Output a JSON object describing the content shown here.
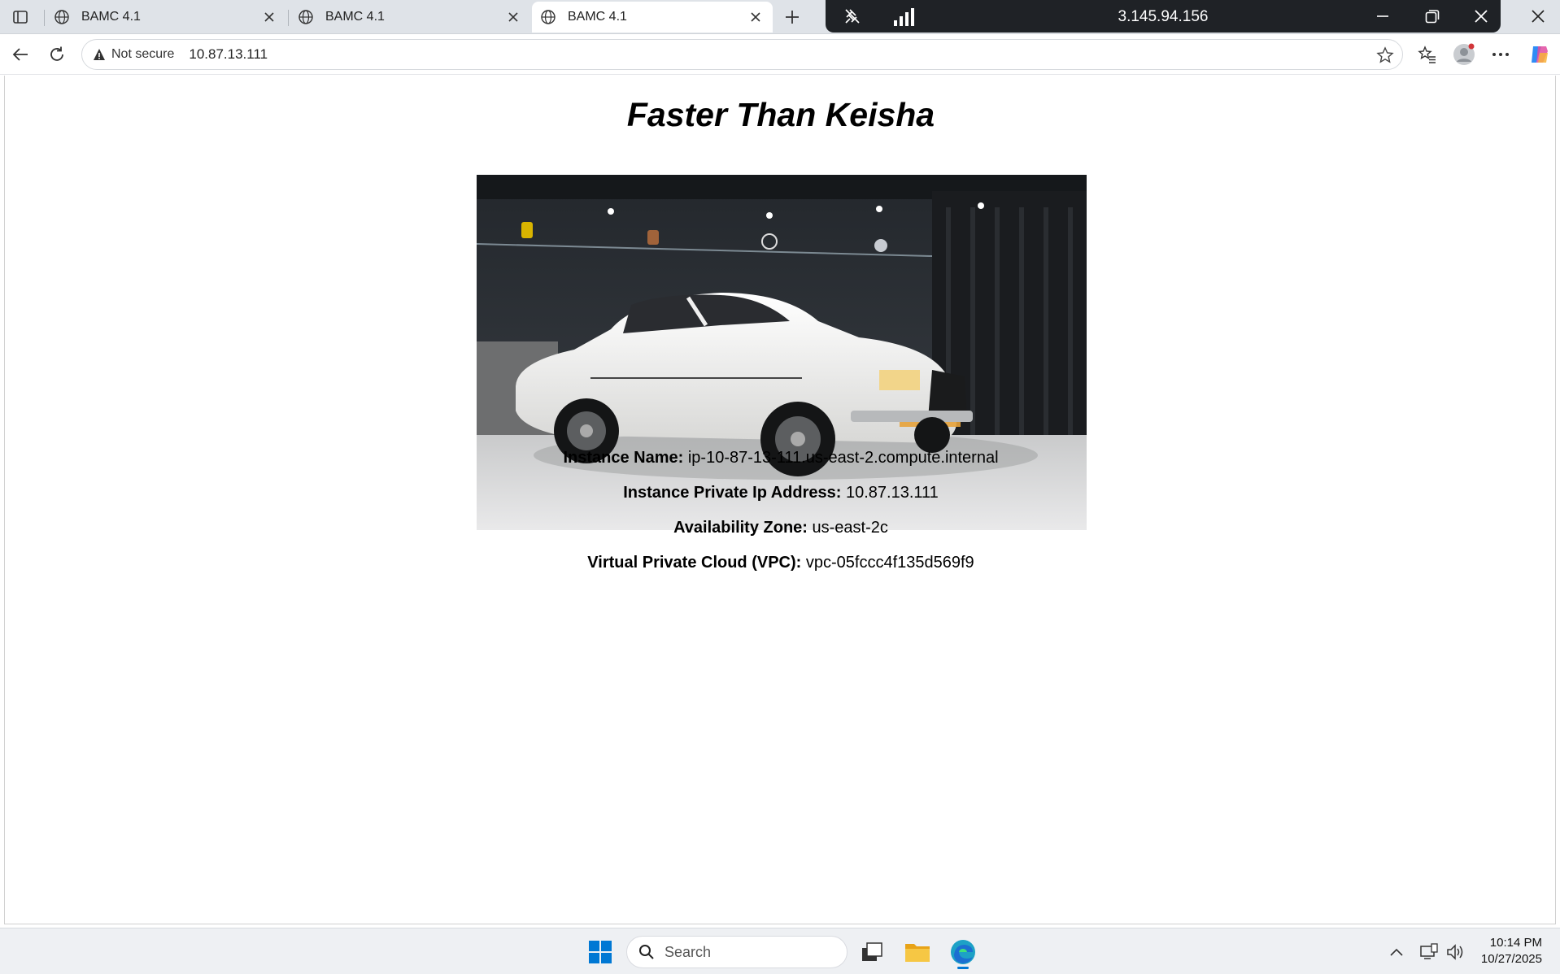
{
  "browser": {
    "tabs": [
      {
        "title": "BAMC 4.1",
        "active": false
      },
      {
        "title": "BAMC 4.1",
        "active": false
      },
      {
        "title": "BAMC 4.1",
        "active": true
      }
    ],
    "address": {
      "security_label": "Not secure",
      "url": "10.87.13.111"
    }
  },
  "remote_session": {
    "host": "3.145.94.156"
  },
  "page": {
    "title": "Faster Than Keisha",
    "image_alt": "Buick",
    "fields": [
      {
        "label": "Instance Name:",
        "value": "ip-10-87-13-111.us-east-2.compute.internal"
      },
      {
        "label": "Instance Private Ip Address:",
        "value": "10.87.13.111"
      },
      {
        "label": "Availability Zone:",
        "value": "us-east-2c"
      },
      {
        "label": "Virtual Private Cloud (VPC):",
        "value": "vpc-05fccc4f135d569f9"
      }
    ]
  },
  "taskbar": {
    "search_placeholder": "Search",
    "time": "10:14 PM",
    "date": "10/27/2025"
  },
  "colors": {
    "accent": "#0078d4",
    "page_bg": "#ffffff",
    "tabstrip_bg": "#dfe3e8",
    "rdp_bar_bg": "#1f2226"
  },
  "icons": [
    "tab-actions-icon",
    "globe-icon",
    "close-icon",
    "plus-icon",
    "pin-icon",
    "signal-icon",
    "minimize-icon",
    "restore-icon",
    "back-icon",
    "refresh-icon",
    "warning-icon",
    "star-icon",
    "favorites-icon",
    "profile-icon",
    "more-icon",
    "copilot-icon",
    "windows-start-icon",
    "search-icon",
    "task-view-icon",
    "file-explorer-icon",
    "edge-icon",
    "chevron-up-icon",
    "network-icon",
    "volume-icon"
  ]
}
